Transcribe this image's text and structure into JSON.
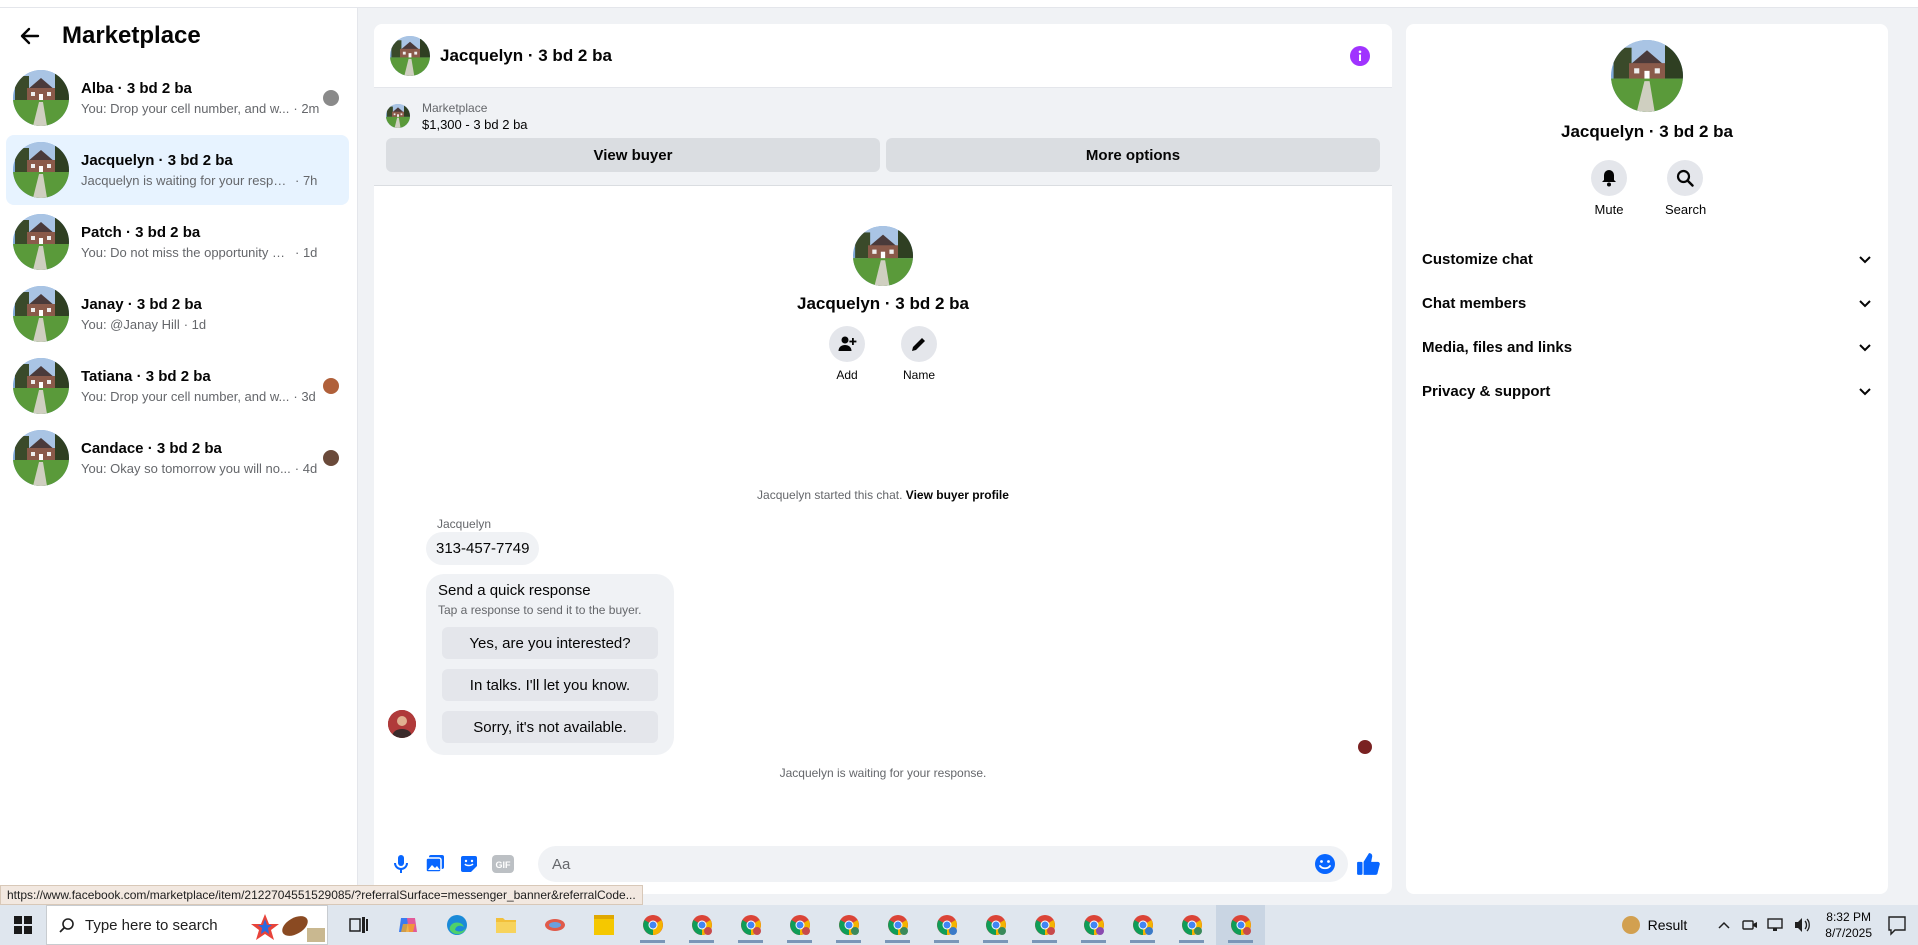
{
  "sidebar": {
    "title": "Marketplace",
    "conversations": [
      {
        "name": "Alba · 3 bd 2 ba",
        "snippet": "You: Drop your cell number, and w...",
        "time": "· 2m",
        "mini_color": "#8a8a8a"
      },
      {
        "name": "Jacquelyn · 3 bd 2 ba",
        "snippet": "Jacquelyn is waiting for your response.",
        "time": "· 7h",
        "mini_color": ""
      },
      {
        "name": "Patch · 3 bd 2 ba",
        "snippet": "You: Do not miss the opportunity and ...",
        "time": "· 1d",
        "mini_color": ""
      },
      {
        "name": "Janay · 3 bd 2 ba",
        "snippet": "You: @Janay Hill",
        "time": "· 1d",
        "mini_color": ""
      },
      {
        "name": "Tatiana · 3 bd 2 ba",
        "snippet": "You: Drop your cell number, and w...",
        "time": "· 3d",
        "mini_color": "#b0603a"
      },
      {
        "name": "Candace · 3 bd 2 ba",
        "snippet": "You: Okay so tomorrow you will no...",
        "time": "· 4d",
        "mini_color": "#6a4a3a"
      }
    ]
  },
  "chat": {
    "title": "Jacquelyn · 3 bd 2 ba",
    "banner": {
      "label": "Marketplace",
      "item": "$1,300 - 3 bd 2 ba",
      "view_buyer": "View buyer",
      "more_options": "More options"
    },
    "profile": {
      "name": "Jacquelyn · 3 bd 2 ba",
      "add_label": "Add",
      "name_label": "Name"
    },
    "started_text": "Jacquelyn started this chat.",
    "started_link": "View buyer profile",
    "sender": "Jacquelyn",
    "phone_message": "313-457-7749",
    "quick": {
      "title": "Send a quick response",
      "subtitle": "Tap a response to send it to the buyer.",
      "options": [
        "Yes, are you interested?",
        "In talks. I'll let you know.",
        "Sorry, it's not available."
      ]
    },
    "waiting": "Jacquelyn is waiting for your response.",
    "composer_placeholder": "Aa"
  },
  "info_panel": {
    "name": "Jacquelyn · 3 bd 2 ba",
    "mute_label": "Mute",
    "search_label": "Search",
    "sections": [
      "Customize chat",
      "Chat members",
      "Media, files and links",
      "Privacy & support"
    ]
  },
  "status_url": "https://www.facebook.com/marketplace/item/2122704551529085/?referralSurface=messenger_banner&referralCode...",
  "taskbar": {
    "search_placeholder": "Type here to search",
    "weather": "Result",
    "time": "8:32 PM",
    "date": "8/7/2025"
  },
  "colors": {
    "accent": "#0866ff",
    "info": "#a033ff",
    "active_row": "#e7f3ff"
  }
}
